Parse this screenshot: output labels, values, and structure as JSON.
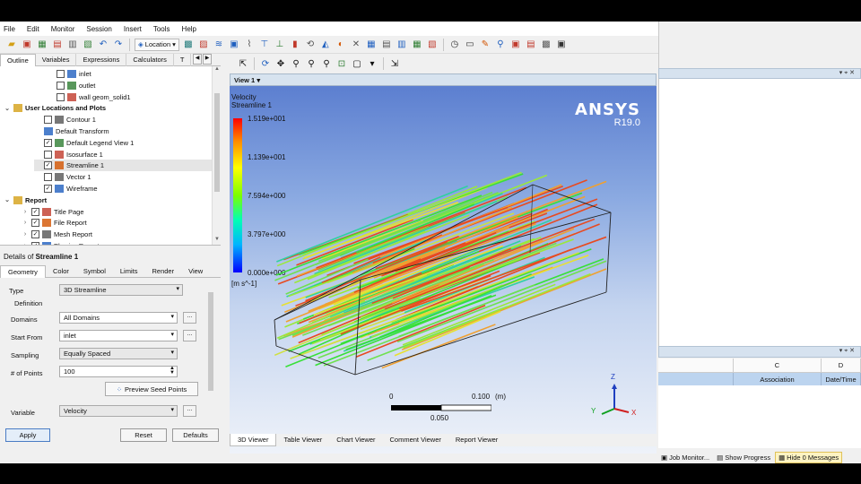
{
  "menu": [
    "File",
    "Edit",
    "Monitor",
    "Session",
    "Insert",
    "Tools",
    "Help"
  ],
  "toolbar": {
    "location_label": "Location"
  },
  "left_tabs": [
    "Outline",
    "Variables",
    "Expressions",
    "Calculators",
    "T"
  ],
  "tree": [
    {
      "label": "inlet",
      "checked": false,
      "indent": 4,
      "bold": false
    },
    {
      "label": "outlet",
      "checked": false,
      "indent": 4,
      "bold": false
    },
    {
      "label": "wall geom_solid1",
      "checked": false,
      "indent": 4,
      "bold": false
    },
    {
      "label": "User Locations and Plots",
      "checked": null,
      "indent": 1,
      "bold": true
    },
    {
      "label": "Contour 1",
      "checked": false,
      "indent": 3,
      "bold": false
    },
    {
      "label": "Default Transform",
      "checked": null,
      "indent": 3,
      "bold": false
    },
    {
      "label": "Default Legend View 1",
      "checked": true,
      "indent": 3,
      "bold": false
    },
    {
      "label": "Isosurface 1",
      "checked": false,
      "indent": 3,
      "bold": false
    },
    {
      "label": "Streamline 1",
      "checked": true,
      "indent": 3,
      "bold": false,
      "selected": true
    },
    {
      "label": "Vector 1",
      "checked": false,
      "indent": 3,
      "bold": false
    },
    {
      "label": "Wireframe",
      "checked": true,
      "indent": 3,
      "bold": false
    },
    {
      "label": "Report",
      "checked": null,
      "indent": 1,
      "bold": true
    },
    {
      "label": "Title Page",
      "checked": true,
      "indent": 2,
      "bold": false
    },
    {
      "label": "File Report",
      "checked": true,
      "indent": 2,
      "bold": false
    },
    {
      "label": "Mesh Report",
      "checked": true,
      "indent": 2,
      "bold": false
    },
    {
      "label": "Physics Report",
      "checked": true,
      "indent": 2,
      "bold": false
    }
  ],
  "details": {
    "prefix": "Details of ",
    "object": "Streamline 1",
    "tabs": [
      "Geometry",
      "Color",
      "Symbol",
      "Limits",
      "Render",
      "View"
    ],
    "type_label": "Type",
    "type_value": "3D Streamline",
    "definition_label": "Definition",
    "domains_label": "Domains",
    "domains_value": "All Domains",
    "start_label": "Start From",
    "start_value": "inlet",
    "sampling_label": "Sampling",
    "sampling_value": "Equally Spaced",
    "points_label": "# of Points",
    "points_value": "100",
    "preview_label": "Preview Seed Points",
    "variable_label": "Variable",
    "variable_value": "Velocity",
    "more_label": "..."
  },
  "buttons": {
    "apply": "Apply",
    "reset": "Reset",
    "defaults": "Defaults"
  },
  "viewer": {
    "title": "View 1",
    "legend_title_1": "Velocity",
    "legend_title_2": "Streamline 1",
    "legend_values": [
      "1.519e+001",
      "1.139e+001",
      "7.594e+000",
      "3.797e+000",
      "0.000e+000"
    ],
    "legend_unit": "[m s^-1]",
    "brand": "ANSYS",
    "version": "R19.0",
    "scale_start": "0",
    "scale_end": "0.100",
    "scale_unit": "(m)",
    "scale_mid": "0.050",
    "axis_x": "X",
    "axis_y": "Y",
    "axis_z": "Z"
  },
  "viewer_tabs": [
    "3D Viewer",
    "Table Viewer",
    "Chart Viewer",
    "Comment Viewer",
    "Report Viewer"
  ],
  "grid": {
    "col_c": "C",
    "col_d": "D",
    "sub_c": "Association",
    "sub_d": "Date/Time"
  },
  "status": [
    "Job Monitor...",
    "Show Progress",
    "Hide 0 Messages"
  ],
  "colors": {
    "accent": "#4a7cc4",
    "viewport_top": "#5c7fd0",
    "panel_header": "#d6e2ef"
  }
}
